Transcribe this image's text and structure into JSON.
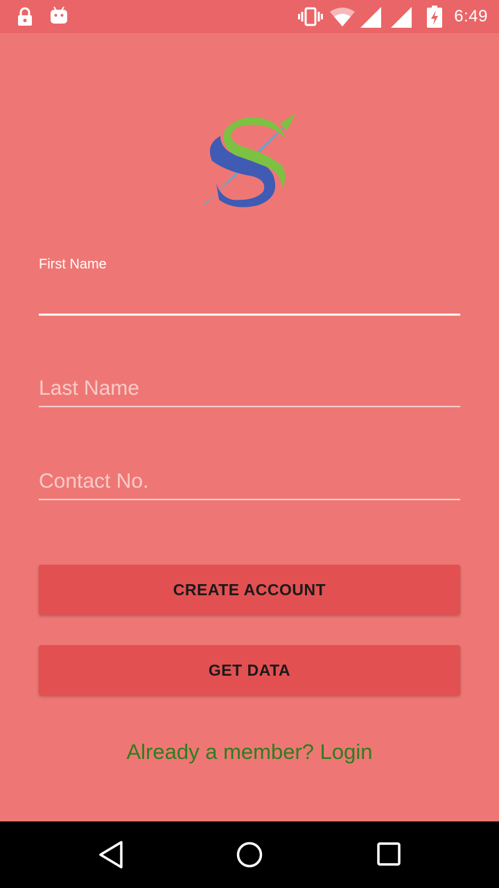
{
  "status_bar": {
    "time": "6:49",
    "left_icons": [
      "lock-icon",
      "android-icon"
    ],
    "right_icons": [
      "vibrate-icon",
      "wifi-icon",
      "signal-icon",
      "signal-icon-2",
      "battery-charging-icon"
    ]
  },
  "logo": {
    "icon": "s-logo",
    "colors": {
      "green": "#7DC143",
      "blue": "#3F5BB4",
      "light_blue": "#4AAEE2"
    }
  },
  "form": {
    "first_name": {
      "label": "First Name",
      "value": "",
      "placeholder": ""
    },
    "last_name": {
      "value": "",
      "placeholder": "Last Name"
    },
    "contact": {
      "value": "",
      "placeholder": "Contact No."
    }
  },
  "buttons": {
    "create_account": "CREATE ACCOUNT",
    "get_data": "GET DATA"
  },
  "login_link": "Already a member? Login",
  "nav_bar": {
    "icons": [
      "back-icon",
      "home-icon",
      "recents-icon"
    ]
  },
  "colors": {
    "background": "#EE7775",
    "status_bar": "#EA6567",
    "button": "#E35052",
    "link": "#2E7D1F",
    "nav_bar": "#000000"
  }
}
